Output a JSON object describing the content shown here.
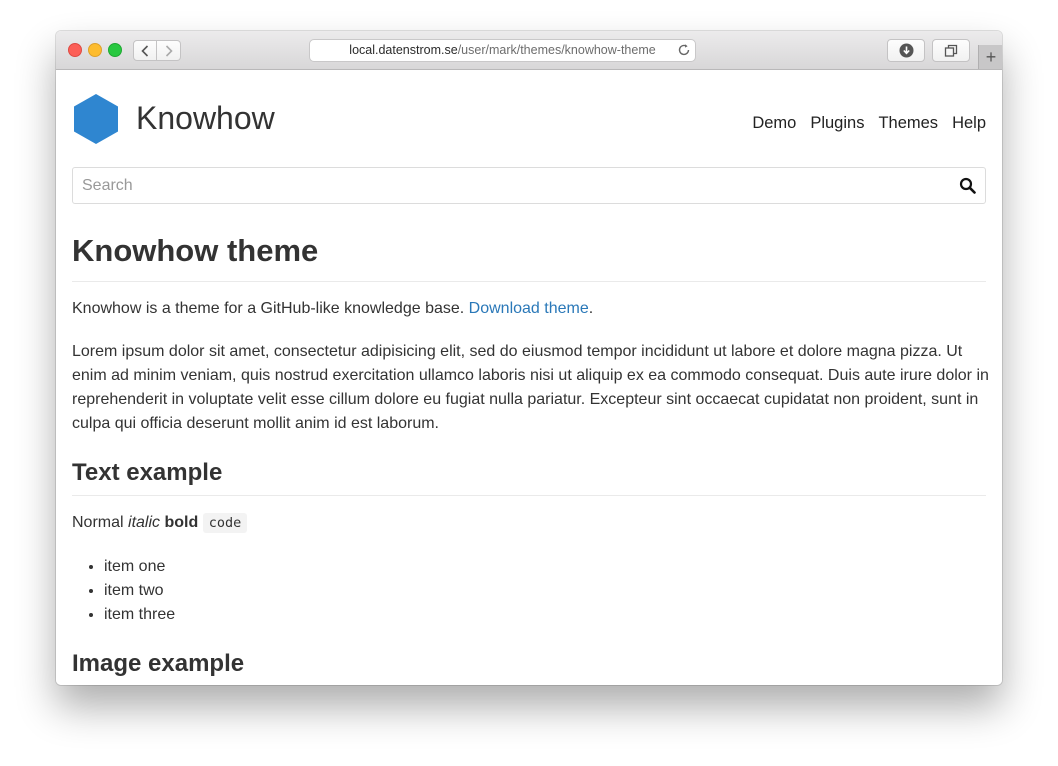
{
  "browser": {
    "url_domain": "local.datenstrom.se",
    "url_path": "/user/mark/themes/knowhow-theme"
  },
  "site": {
    "name": "Knowhow",
    "logo_color": "#2f86d0",
    "nav": [
      "Demo",
      "Plugins",
      "Themes",
      "Help"
    ]
  },
  "search": {
    "placeholder": "Search",
    "value": ""
  },
  "page": {
    "title": "Knowhow theme",
    "intro_text": "Knowhow is a theme for a GitHub-like knowledge base. ",
    "intro_link": "Download theme",
    "intro_end": ".",
    "lorem": "Lorem ipsum dolor sit amet, consectetur adipisicing elit, sed do eiusmod tempor incididunt ut labore et dolore magna pizza. Ut enim ad minim veniam, quis nostrud exercitation ullamco laboris nisi ut aliquip ex ea commodo consequat. Duis aute irure dolor in reprehenderit in voluptate velit esse cillum dolore eu fugiat nulla pariatur. Excepteur sint occaecat cupidatat non proident, sunt in culpa qui officia deserunt mollit anim id est laborum.",
    "text_heading": "Text example",
    "text_normal": "Normal ",
    "text_italic": "italic",
    "text_bold": "bold",
    "text_code": "code",
    "list_items": [
      "item one",
      "item two",
      "item three"
    ],
    "image_heading": "Image example"
  }
}
